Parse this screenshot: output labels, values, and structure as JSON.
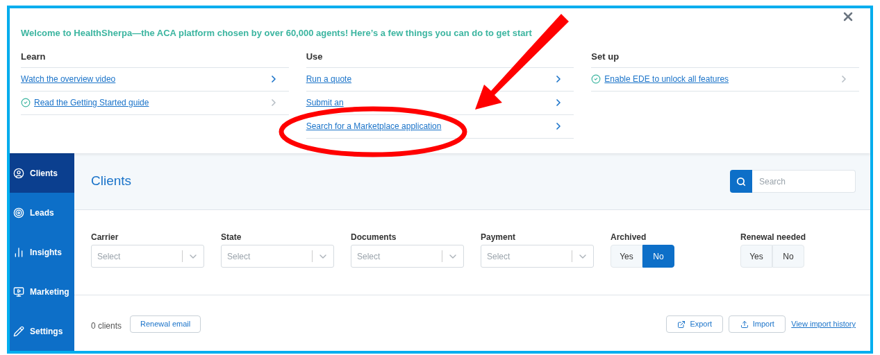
{
  "welcome": {
    "title": "Welcome to HealthSherpa—the ACA platform chosen by over 60,000 agents! Here’s a few things you can do to get start",
    "columns": [
      {
        "heading": "Learn",
        "items": [
          {
            "label": "Watch the overview video",
            "completed": false
          },
          {
            "label": "Read the Getting Started guide",
            "completed": true
          }
        ]
      },
      {
        "heading": "Use",
        "items": [
          {
            "label": "Run a quote",
            "completed": false
          },
          {
            "label": "Submit an",
            "completed": false
          },
          {
            "label": "Search for a Marketplace application",
            "completed": false
          }
        ]
      },
      {
        "heading": "Set up",
        "items": [
          {
            "label": "Enable EDE to unlock all features",
            "completed": true
          }
        ]
      }
    ]
  },
  "sidebar": {
    "items": [
      {
        "label": "Clients",
        "kind": "person",
        "selected": true
      },
      {
        "label": "Leads",
        "kind": "target",
        "selected": false
      },
      {
        "label": "Insights",
        "kind": "chart",
        "selected": false
      },
      {
        "label": "Marketing",
        "kind": "monitor",
        "selected": false
      },
      {
        "label": "Settings",
        "kind": "pencil",
        "selected": false
      }
    ]
  },
  "header": {
    "title": "Clients",
    "search": {
      "placeholder": "Search"
    }
  },
  "filters": [
    {
      "kind": "select",
      "label": "Carrier",
      "placeholder": "Select"
    },
    {
      "kind": "select",
      "label": "State",
      "placeholder": "Select"
    },
    {
      "kind": "select",
      "label": "Documents",
      "placeholder": "Select"
    },
    {
      "kind": "select",
      "label": "Payment",
      "placeholder": "Select"
    },
    {
      "kind": "toggle",
      "label": "Archived",
      "options": [
        {
          "label": "Yes",
          "selected": false
        },
        {
          "label": "No",
          "selected": true
        }
      ]
    },
    {
      "kind": "toggle",
      "label": "Renewal needed",
      "options": [
        {
          "label": "Yes",
          "selected": false
        },
        {
          "label": "No",
          "selected": false
        }
      ]
    }
  ],
  "footer": {
    "count": "0 clients",
    "renewal_button": "Renewal email",
    "export_button": "Export",
    "import_button": "Import",
    "history_link": "View import history"
  }
}
